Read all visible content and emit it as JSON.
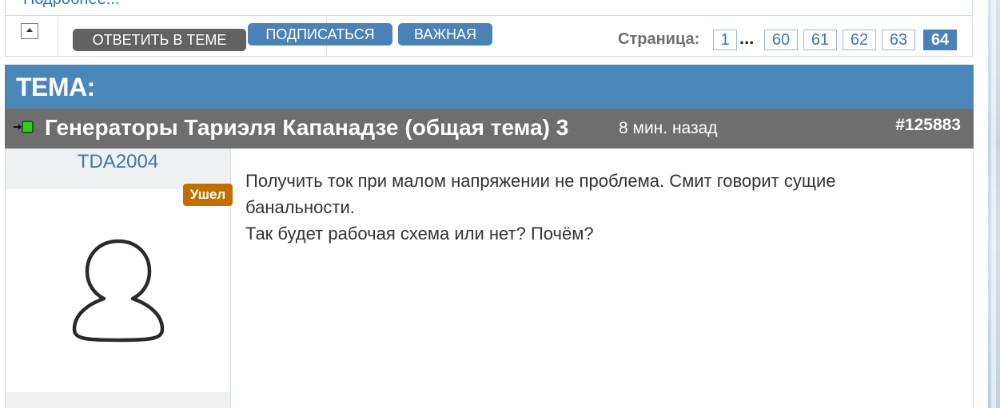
{
  "top": {
    "truncated_link": "Подробнее..."
  },
  "toolbar": {
    "reply_label": "ОТВЕТИТЬ В ТЕМЕ",
    "subscribe_label": "ПОДПИСАТЬСЯ",
    "important_label": "ВАЖНАЯ",
    "scroll_top_icon": "arrow-up-icon"
  },
  "pagination": {
    "label": "Страница:",
    "first": "1",
    "ellipsis": "...",
    "pages": [
      "60",
      "61",
      "62",
      "63"
    ],
    "current": "64"
  },
  "topic": {
    "header_label": "ТЕМА:",
    "status_icon": "new-post-indicator-icon",
    "title": "Генераторы Тариэля Капанадзе (общая тема) 3",
    "time": "8 мин. назад",
    "post_number": "#125883"
  },
  "post": {
    "author": "TDA2004",
    "author_status": "Ушел",
    "avatar_icon": "default-user-avatar-icon",
    "lines": [
      "Получить ток при малом напряжении не проблема. Смит говорит сущие",
      "банальности.",
      "Так будет рабочая схема или нет? Почём?"
    ]
  },
  "colors": {
    "accent_blue": "#4a86b8",
    "button_gray": "#626262",
    "thread_bar": "#6e6e6e",
    "status_orange": "#c36f00",
    "link_blue": "#3a78ae"
  }
}
